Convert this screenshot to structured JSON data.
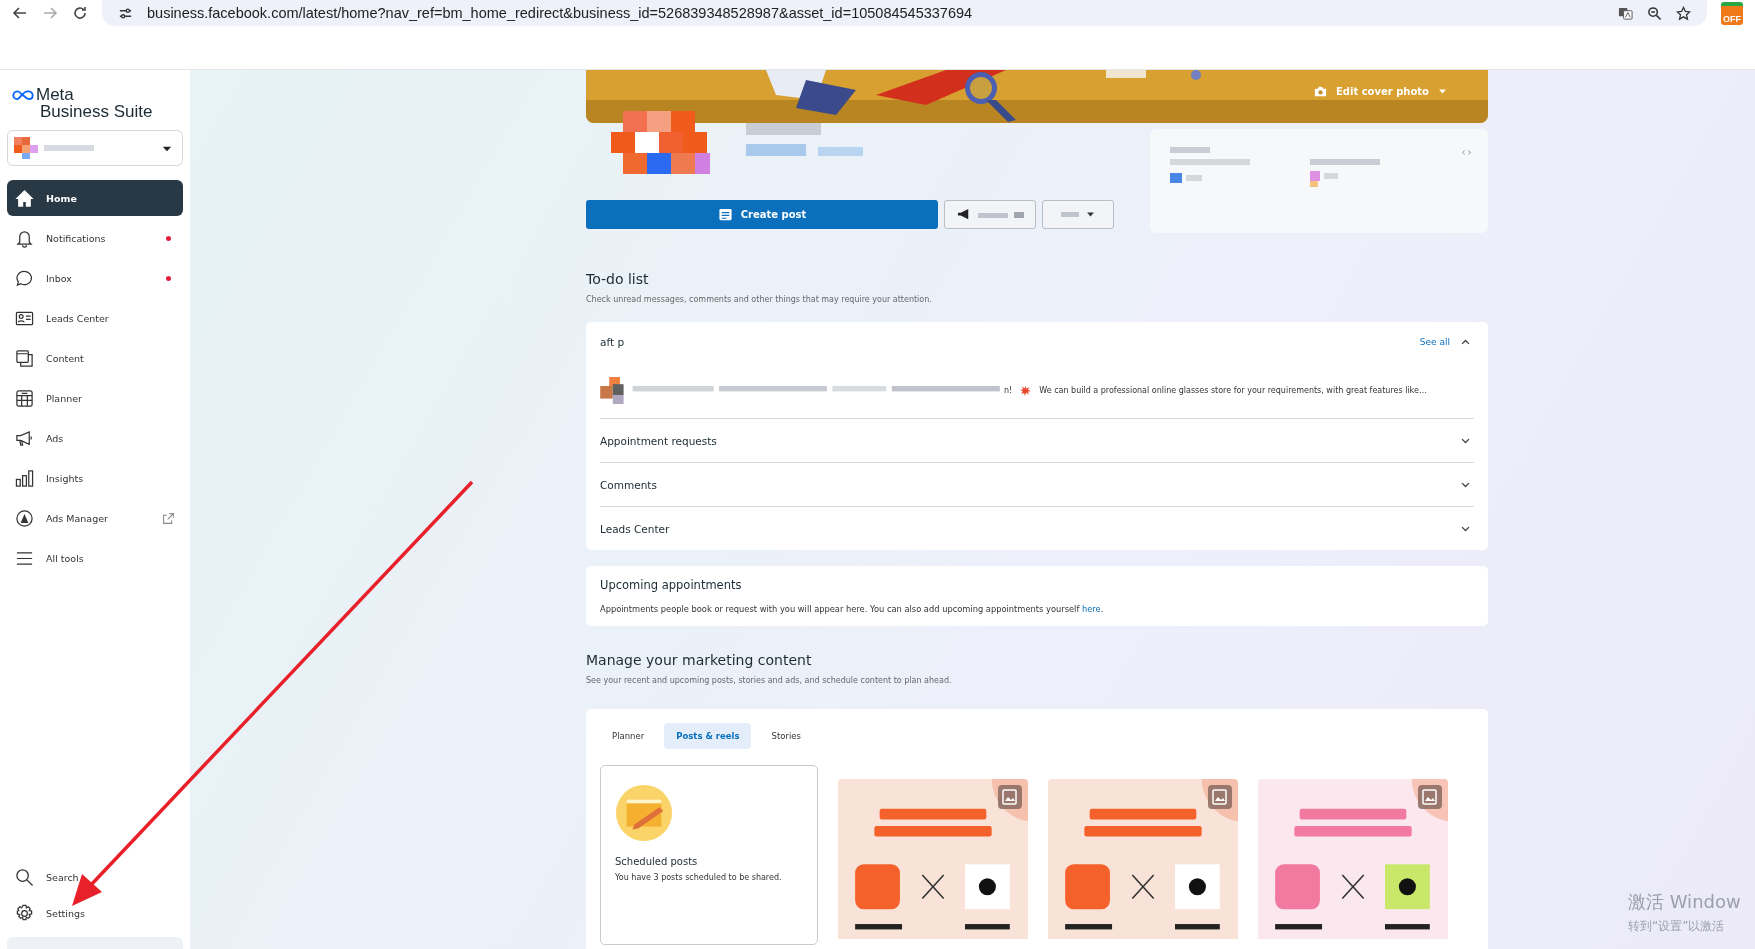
{
  "browser": {
    "url": "business.facebook.com/latest/home?nav_ref=bm_home_redirect&business_id=526839348528987&asset_id=105084545337694",
    "forward_disabled": true,
    "extension_badge": "OFF"
  },
  "sidebar": {
    "logo_top": "Meta",
    "logo_bottom": "Business Suite",
    "items": [
      {
        "label": "Home",
        "selected": true,
        "unread": false,
        "external": false
      },
      {
        "label": "Notifications",
        "selected": false,
        "unread": true,
        "external": false
      },
      {
        "label": "Inbox",
        "selected": false,
        "unread": true,
        "external": false
      },
      {
        "label": "Leads Center",
        "selected": false,
        "unread": false,
        "external": false
      },
      {
        "label": "Content",
        "selected": false,
        "unread": false,
        "external": false
      },
      {
        "label": "Planner",
        "selected": false,
        "unread": false,
        "external": false
      },
      {
        "label": "Ads",
        "selected": false,
        "unread": false,
        "external": false
      },
      {
        "label": "Insights",
        "selected": false,
        "unread": false,
        "external": false
      },
      {
        "label": "Ads Manager",
        "selected": false,
        "unread": false,
        "external": true
      },
      {
        "label": "All tools",
        "selected": false,
        "unread": false,
        "external": false
      }
    ],
    "bottom_items": [
      {
        "label": "Search"
      },
      {
        "label": "Settings"
      }
    ]
  },
  "header": {
    "edit_cover": "Edit cover photo",
    "create_post": "Create post"
  },
  "todo": {
    "title": "To-do list",
    "subtitle": "Check unread messages, comments and other things that may require your attention.",
    "draft": {
      "label": "aft p",
      "see_all": "See all",
      "expanded": true,
      "text_start": "n!",
      "text": "We can build a professional online glasses store for your requirements, with great features like…"
    },
    "sections": [
      {
        "label": "Appointment requests",
        "expanded": false
      },
      {
        "label": "Comments",
        "expanded": false
      },
      {
        "label": "Leads Center",
        "expanded": false
      }
    ]
  },
  "appointments": {
    "title": "Upcoming appointments",
    "text": "Appointments people book or request with you will appear here. You can also add upcoming appointments yourself",
    "link": "here",
    "end": "."
  },
  "marketing": {
    "title": "Manage your marketing content",
    "subtitle": "See your recent and upcoming posts, stories and ads, and schedule content to plan ahead.",
    "tabs": [
      {
        "label": "Planner",
        "selected": false
      },
      {
        "label": "Posts & reels",
        "selected": true
      },
      {
        "label": "Stories",
        "selected": false
      }
    ],
    "scheduled": {
      "title": "Scheduled posts",
      "text": "You have 3 posts scheduled to be shared."
    }
  },
  "os_notice": {
    "line1": "激活 Window",
    "line2": "转到“设置”以激活"
  }
}
